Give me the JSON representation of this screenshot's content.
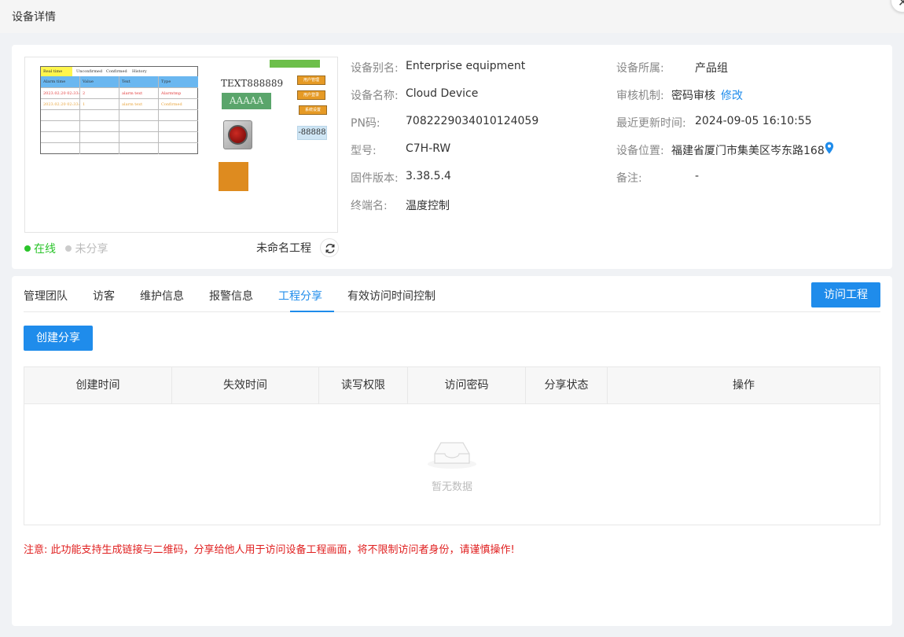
{
  "dialog": {
    "title": "设备详情",
    "close_label": "✕"
  },
  "preview": {
    "tabs": [
      "Real time",
      "Unconfirmed",
      "Confirmed",
      "History"
    ],
    "columns": [
      "Alarm time",
      "Value",
      "Text",
      "Type"
    ],
    "rows": [
      {
        "time": "2023.02.20 02:33:04",
        "value": "2",
        "text": "alarm text",
        "type": "Alarmtmp"
      },
      {
        "time": "2023.02.20 02:33:05",
        "value": "1",
        "text": "alarm text",
        "type": "Confirmed"
      }
    ],
    "text_label": "TEXT888889",
    "green_label": "AAAAA",
    "btn_labels": [
      "用户管理",
      "用户登录",
      "系统设置"
    ],
    "num_display": "-88888"
  },
  "status": {
    "online": "在线",
    "shared": "未分享"
  },
  "project": {
    "name": "未命名工程"
  },
  "info": {
    "alias_label": "设备别名:",
    "alias_value": "Enterprise equipment",
    "name_label": "设备名称:",
    "name_value": "Cloud Device",
    "pn_label": "PN码:",
    "pn_value": "7082229034010124059",
    "model_label": "型号:",
    "model_value": "C7H-RW",
    "firmware_label": "固件版本:",
    "firmware_value": "3.38.5.4",
    "terminal_label": "终端名:",
    "terminal_value": "温度控制",
    "group_label": "设备所属:",
    "group_value": "产品组",
    "audit_label": "审核机制:",
    "audit_value": "密码审核",
    "audit_edit": "修改",
    "updated_label": "最近更新时间:",
    "updated_value": "2024-09-05 16:10:55",
    "location_label": "设备位置:",
    "location_value": "福建省厦门市集美区岑东路168",
    "remark_label": "备注:",
    "remark_value": "-"
  },
  "tabs": [
    "管理团队",
    "访客",
    "维护信息",
    "报警信息",
    "工程分享",
    "有效访问时间控制"
  ],
  "active_tab": "工程分享",
  "buttons": {
    "visit": "访问工程",
    "create": "创建分享"
  },
  "table": {
    "headers": [
      "创建时间",
      "失效时间",
      "读写权限",
      "访问密码",
      "分享状态",
      "操作"
    ],
    "empty_text": "暂无数据"
  },
  "notice": "注意: 此功能支持生成链接与二维码，分享给他人用于访问设备工程画面，将不限制访问者身份，请谨慎操作!",
  "colors": {
    "primary": "#1f8ceb",
    "online": "#2bc42b",
    "warning": "#e02020"
  }
}
